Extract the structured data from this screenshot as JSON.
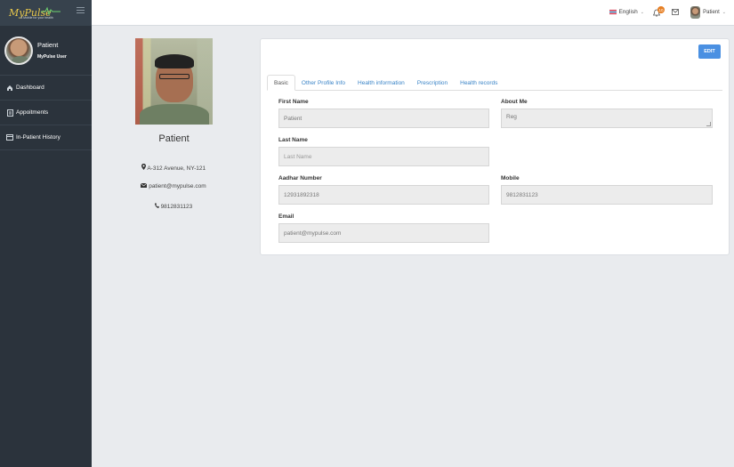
{
  "brand": {
    "logo_text": "MyPulse",
    "tagline": "A Mobile for your health"
  },
  "sidebar": {
    "user": {
      "name": "Patient",
      "role": "MyPulse User"
    },
    "items": [
      {
        "label": "Dashboard",
        "icon": "home-icon"
      },
      {
        "label": "Appoitments",
        "icon": "document-icon"
      },
      {
        "label": "In-Patient History",
        "icon": "card-icon"
      }
    ]
  },
  "header": {
    "language": "English",
    "notification_count": "10",
    "user_name": "Patient"
  },
  "profile": {
    "name": "Patient",
    "address": "A-312 Avenue, NY-121",
    "email": "patient@mypulse.com",
    "phone": "9812831123"
  },
  "card": {
    "edit_label": "EDIT",
    "tabs": [
      "Basic",
      "Other Profile Info",
      "Health information",
      "Prescription",
      "Health records"
    ],
    "active_tab": "Basic",
    "fields": {
      "first_name": {
        "label": "First Name",
        "value": "Patient"
      },
      "about_me": {
        "label": "About Me",
        "value": "Reg"
      },
      "last_name": {
        "label": "Last Name",
        "placeholder": "Last Name"
      },
      "aadhar": {
        "label": "Aadhar Number",
        "value": "12931892318"
      },
      "mobile": {
        "label": "Mobile",
        "value": "9812831123"
      },
      "email": {
        "label": "Email",
        "value": "patient@mypulse.com"
      }
    }
  },
  "colors": {
    "sidebar": "#2b333c",
    "accent": "#4a90e2",
    "badge": "#e67e22",
    "logo": "#e8c84c"
  }
}
